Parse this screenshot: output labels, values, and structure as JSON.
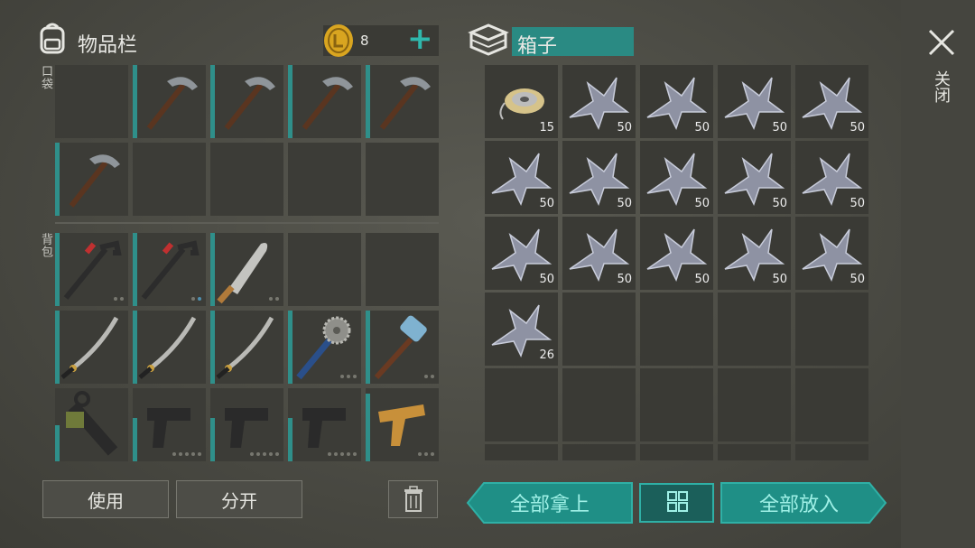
{
  "inventory": {
    "title": "物品栏",
    "coins": "8",
    "plus": "+",
    "pocket_label": "口袋",
    "backpack_label": "背包",
    "use_label": "使用",
    "split_label": "分开"
  },
  "container": {
    "title": "箱子",
    "close_label": "关闭",
    "take_all_label": "全部拿上",
    "put_all_label": "全部放入",
    "counts": [
      "15",
      "50",
      "50",
      "50",
      "50",
      "50",
      "50",
      "50",
      "50",
      "50",
      "50",
      "50",
      "50",
      "50",
      "50",
      "26"
    ]
  },
  "colors": {
    "accent": "#1f8f86",
    "durability": "#2f8f8a",
    "coin": "#d9a520"
  }
}
